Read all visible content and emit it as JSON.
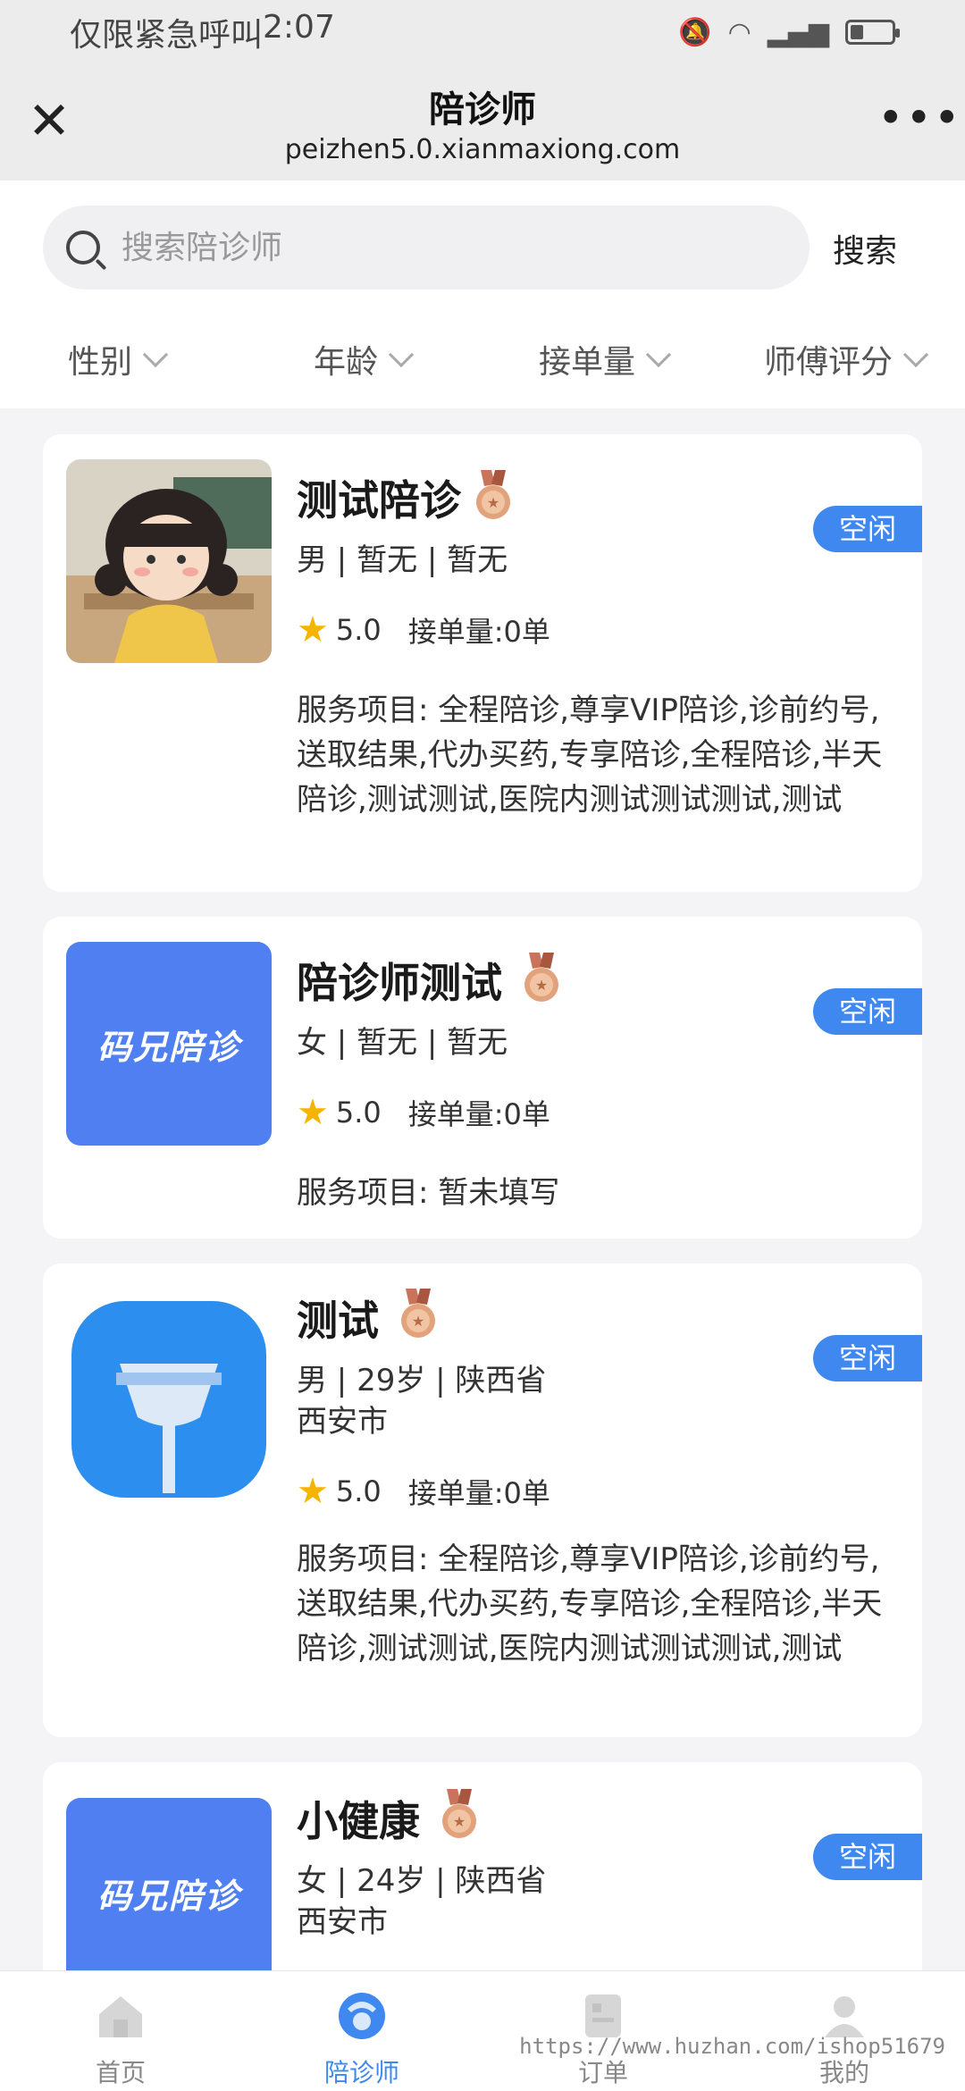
{
  "status_bar": {
    "carrier": "仅限紧急呼叫",
    "time": "2:07"
  },
  "header": {
    "title": "陪诊师",
    "url": "peizhen5.0.xianmaxiong.com"
  },
  "search": {
    "placeholder": "搜索陪诊师",
    "button_label": "搜索"
  },
  "filters": [
    "性别",
    "年龄",
    "接单量",
    "师傅评分"
  ],
  "escorts": [
    {
      "name": "测试陪诊",
      "meta_line1": "男 | 暂无 | 暂无",
      "meta_line2": "",
      "rating": "5.0",
      "orders": "接单量:0单",
      "status": "空闲",
      "services": "服务项目:  全程陪诊,尊享VIP陪诊,诊前约号,送取结果,代办买药,专享陪诊,全程陪诊,半天陪诊,测试测试,医院内测试测试测试,测试"
    },
    {
      "name": "陪诊师测试",
      "meta_line1": "女 | 暂无 | 暂无",
      "meta_line2": "",
      "rating": "5.0",
      "orders": "接单量:0单",
      "status": "空闲",
      "logo_text": "码兄陪诊",
      "services": "服务项目:  暂未填写"
    },
    {
      "name": "测试",
      "meta_line1": "男 | 29岁 | 陕西省",
      "meta_line2": "西安市",
      "rating": "5.0",
      "orders": "接单量:0单",
      "status": "空闲",
      "services": "服务项目:  全程陪诊,尊享VIP陪诊,诊前约号,送取结果,代办买药,专享陪诊,全程陪诊,半天陪诊,测试测试,医院内测试测试测试,测试"
    },
    {
      "name": "小健康",
      "meta_line1": "女 | 24岁 | 陕西省",
      "meta_line2": "西安市",
      "status": "空闲",
      "logo_text": "码兄陪诊"
    }
  ],
  "tabs": [
    {
      "label": "首页",
      "icon": "home-icon"
    },
    {
      "label": "陪诊师",
      "icon": "escort-icon"
    },
    {
      "label": "订单",
      "icon": "order-icon"
    },
    {
      "label": "我的",
      "icon": "profile-icon"
    }
  ],
  "watermark": "https://www.huzhan.com/ishop51679",
  "colors": {
    "accent": "#3e88f0",
    "logo_bg": "#4f7ff0",
    "star": "#f5b400"
  }
}
